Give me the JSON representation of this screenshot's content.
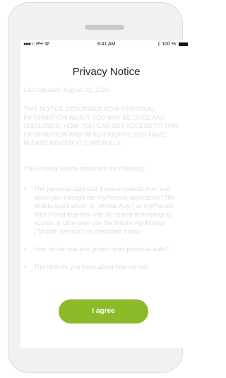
{
  "status_bar": {
    "carrier": "PH",
    "time": "9:41 AM",
    "battery": "100 %"
  },
  "title": "Privacy Notice",
  "last_updated": "Last updated: August 21, 2020",
  "notice": "THIS NOTICE DESCRIBES HOW PERSONAL INFORMATION ABOUT YOU MAY BE USED AND DISCLOSED, HOW YOU CAN GET ACCESS TO THIS INFORMATION AND WHICH RIGHTS YOU HAVE. PLEASE REVIEW IT CAREFULLY.",
  "intro": "This Privacy Notice describes the following:",
  "bullets": [
    "The personal data that Sonova collects from and about you through the myPhonak application (\"the Mobile Application\" or „Mobile App\") or myPhonak Web Portal together with all related technology to access or otherwise use the Mobile Application (\"Mobile Service\") as described below.",
    "How do we use and protect your personal data?",
    "The choices you have about how we use"
  ],
  "agree_label": "I agree"
}
